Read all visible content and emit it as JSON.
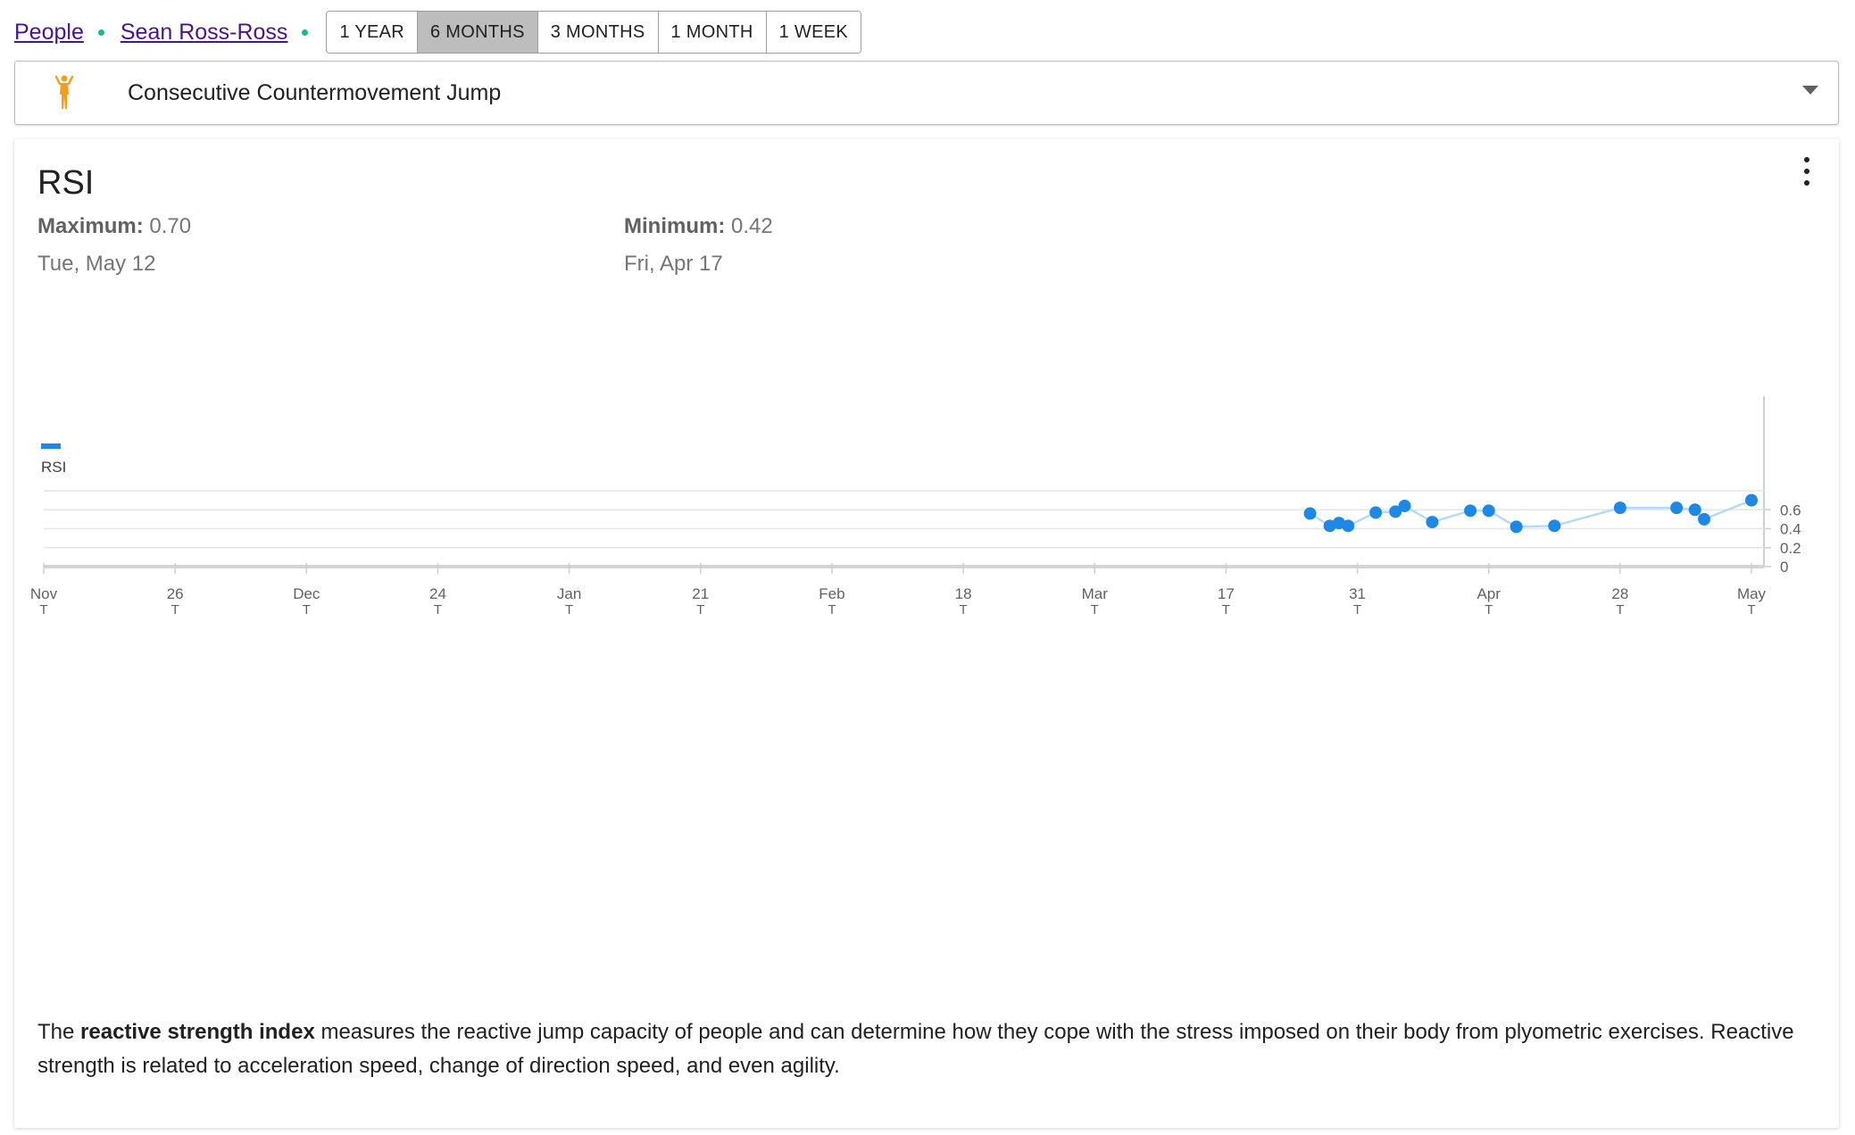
{
  "breadcrumb": {
    "people_label": "People",
    "person_label": "Sean Ross-Ross"
  },
  "time_ranges": [
    {
      "label": "1 YEAR",
      "active": false
    },
    {
      "label": "6 MONTHS",
      "active": true
    },
    {
      "label": "3 MONTHS",
      "active": false
    },
    {
      "label": "1 MONTH",
      "active": false
    },
    {
      "label": "1 WEEK",
      "active": false
    }
  ],
  "test_select": {
    "icon": "jumping-person-icon",
    "selected": "Consecutive Countermovement Jump"
  },
  "metric": {
    "title": "RSI",
    "maximum_label": "Maximum:",
    "maximum_value": "0.70",
    "maximum_date": "Tue, May 12",
    "minimum_label": "Minimum:",
    "minimum_value": "0.42",
    "minimum_date": "Fri, Apr 17"
  },
  "chart_data": {
    "type": "line",
    "x_ticks": [
      {
        "label": "Nov",
        "sub": "T"
      },
      {
        "label": "26",
        "sub": "T"
      },
      {
        "label": "Dec",
        "sub": "T"
      },
      {
        "label": "24",
        "sub": "T"
      },
      {
        "label": "Jan",
        "sub": "T"
      },
      {
        "label": "21",
        "sub": "T"
      },
      {
        "label": "Feb",
        "sub": "T"
      },
      {
        "label": "18",
        "sub": "T"
      },
      {
        "label": "Mar",
        "sub": "T"
      },
      {
        "label": "17",
        "sub": "T"
      },
      {
        "label": "31",
        "sub": "T"
      },
      {
        "label": "Apr",
        "sub": "T"
      },
      {
        "label": "28",
        "sub": "T"
      },
      {
        "label": "May",
        "sub": "T"
      }
    ],
    "y_ticks": [
      "0",
      "0.2",
      "0.4",
      "0.6"
    ],
    "ylim": [
      0,
      0.8
    ],
    "grid": true,
    "legend": "top-left",
    "point_color": "#1e88e5",
    "line_color": "#b3dbf5",
    "series": [
      {
        "name": "RSI",
        "x": [
          9.64,
          9.79,
          9.86,
          9.93,
          10.14,
          10.29,
          10.36,
          10.57,
          10.86,
          11.0,
          11.21,
          11.5,
          12.0,
          12.43,
          12.57,
          12.64,
          13.0
        ],
        "values": [
          0.56,
          0.43,
          0.46,
          0.43,
          0.57,
          0.58,
          0.64,
          0.47,
          0.59,
          0.59,
          0.42,
          0.43,
          0.62,
          0.62,
          0.6,
          0.5,
          0.7
        ]
      }
    ]
  },
  "description": {
    "prefix": "The ",
    "bold": "reactive strength index",
    "suffix": " measures the reactive jump capacity of people and can determine how they cope with the stress imposed on their body from plyometric exercises. Reactive strength is related to acceleration speed, change of direction speed, and even agility."
  }
}
